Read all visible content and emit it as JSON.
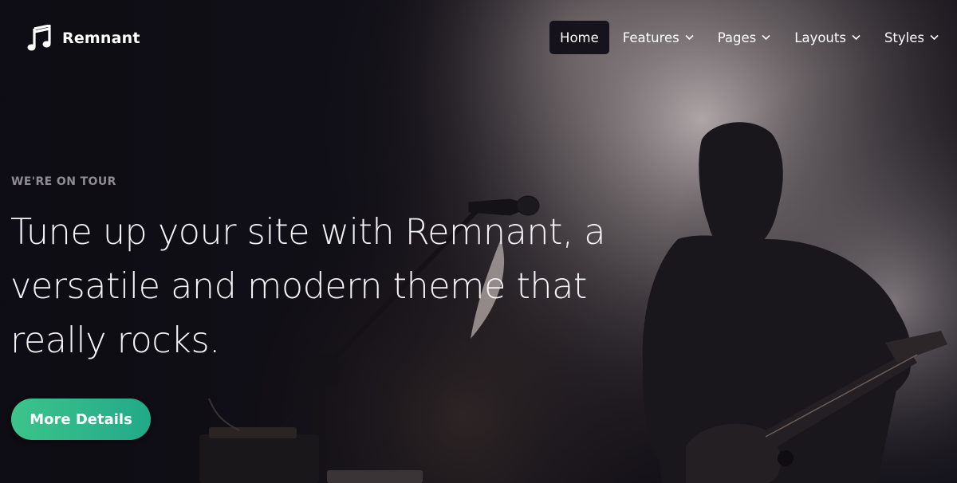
{
  "header": {
    "brand_name": "Remnant",
    "brand_icon": "music-note-icon"
  },
  "nav": {
    "items": [
      {
        "label": "Home",
        "active": true,
        "has_dropdown": false
      },
      {
        "label": "Features",
        "active": false,
        "has_dropdown": true
      },
      {
        "label": "Pages",
        "active": false,
        "has_dropdown": true
      },
      {
        "label": "Layouts",
        "active": false,
        "has_dropdown": true
      },
      {
        "label": "Styles",
        "active": false,
        "has_dropdown": true
      }
    ]
  },
  "hero": {
    "eyebrow": "WE'RE ON TOUR",
    "headline": "Tune up your site with Remnant, a versatile and modern theme that really rocks.",
    "cta_label": "More Details",
    "background": "concert-guitarist-photo"
  },
  "colors": {
    "background_dark": "#0e0d14",
    "cta_start": "#3cc48a",
    "cta_end": "#22a989",
    "eyebrow": "#8e8b93",
    "text": "#ffffff"
  }
}
